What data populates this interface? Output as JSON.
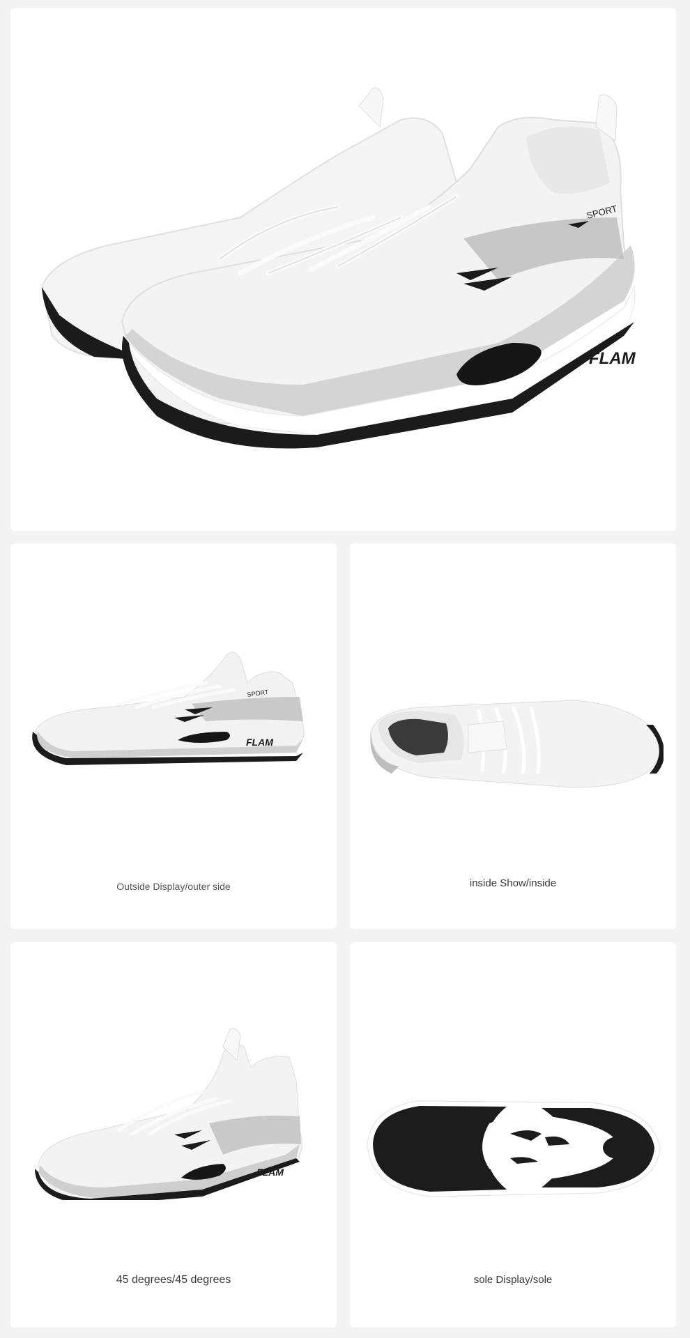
{
  "brand": {
    "logo_text": "FLAM",
    "tag_text": "SPORT"
  },
  "gallery": {
    "hero": {
      "image": "white-running-shoe-pair"
    },
    "tiles": [
      {
        "image": "shoe-outer-side",
        "caption": "Outside Display/outer side"
      },
      {
        "image": "shoe-inside-top",
        "caption": "inside Show/inside"
      },
      {
        "image": "shoe-45-degrees",
        "caption": "45 degrees/45 degrees"
      },
      {
        "image": "shoe-sole",
        "caption": "sole Display/sole"
      }
    ]
  },
  "colors": {
    "page_bg": "#f3f3f3",
    "card_bg": "#ffffff",
    "upper": "#f2f2f2",
    "midsole_grey": "#c9c9c9",
    "outsole_black": "#1b1b1b"
  }
}
